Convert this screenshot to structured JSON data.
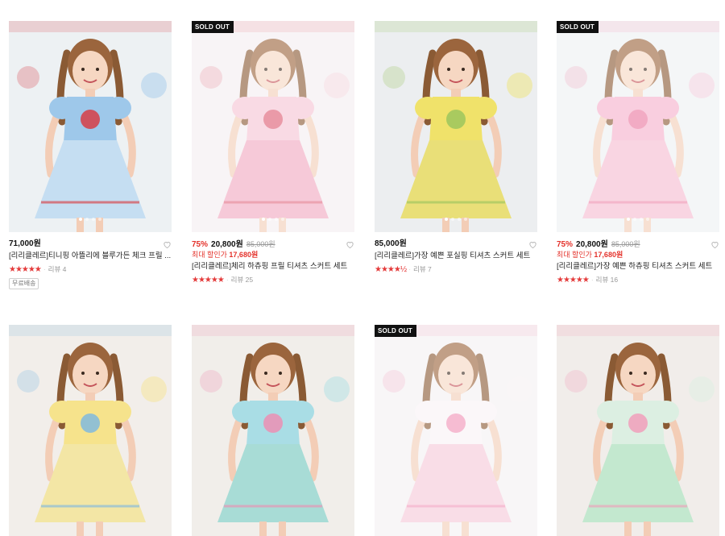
{
  "badges": {
    "soldout": "SOLD OUT"
  },
  "products": [
    {
      "price": "71,000원",
      "title": "[리리클레르]티니핑 아뜰리에 블루가든 체크 프릴 ...",
      "stars": "★★★★★",
      "review": "리뷰 4",
      "tag": "무료배송",
      "soldout": false,
      "palette": {
        "bg": "#edf1f3",
        "top": "#9ec8ea",
        "skirt": "#c5def2",
        "accent": "#d9353b"
      }
    },
    {
      "discount": "75%",
      "price": "20,800원",
      "original": "85,000원",
      "max_label": "최대 할인가",
      "max_price": "17,680원",
      "title": "[리리클레르]체리 하츄핑 프릴 티셔츠 스커트 세트",
      "stars": "★★★★★",
      "review": "리뷰 25",
      "soldout": true,
      "palette": {
        "bg": "#f4eef0",
        "top": "#f5c3d3",
        "skirt": "#f0a9c0",
        "accent": "#d8445b"
      }
    },
    {
      "price": "85,000원",
      "title": "[리리클레르]가장 예쁜 포실핑 티셔츠 스커트 세트",
      "stars": "★★★★½",
      "review": "리뷰 7",
      "soldout": false,
      "palette": {
        "bg": "#eceef0",
        "top": "#f0e26a",
        "skirt": "#e9df78",
        "accent": "#97c45c"
      }
    },
    {
      "discount": "75%",
      "price": "20,800원",
      "original": "85,000원",
      "max_label": "최대 할인가",
      "max_price": "17,680원",
      "title": "[리리클레르]가장 예쁜 하츄핑 티셔츠 스커트 세트",
      "stars": "★★★★★",
      "review": "리뷰 16",
      "soldout": true,
      "palette": {
        "bg": "#eef0f2",
        "top": "#f5b1cb",
        "skirt": "#f6bcd1",
        "accent": "#e86a95"
      }
    },
    {
      "soldout": false,
      "palette": {
        "bg": "#f2eeea",
        "top": "#f6e38c",
        "skirt": "#f3e6a5",
        "accent": "#79b6e3"
      }
    },
    {
      "soldout": false,
      "palette": {
        "bg": "#f1eeea",
        "top": "#a9dde5",
        "skirt": "#a8dcd6",
        "accent": "#f08bb0"
      }
    },
    {
      "soldout": true,
      "palette": {
        "bg": "#f4f1f2",
        "top": "#f8f2f5",
        "skirt": "#f6c9d9",
        "accent": "#ef7aa6"
      }
    },
    {
      "soldout": false,
      "palette": {
        "bg": "#f1edea",
        "top": "#dcefe2",
        "skirt": "#c3e8cf",
        "accent": "#f29ab9"
      }
    }
  ]
}
